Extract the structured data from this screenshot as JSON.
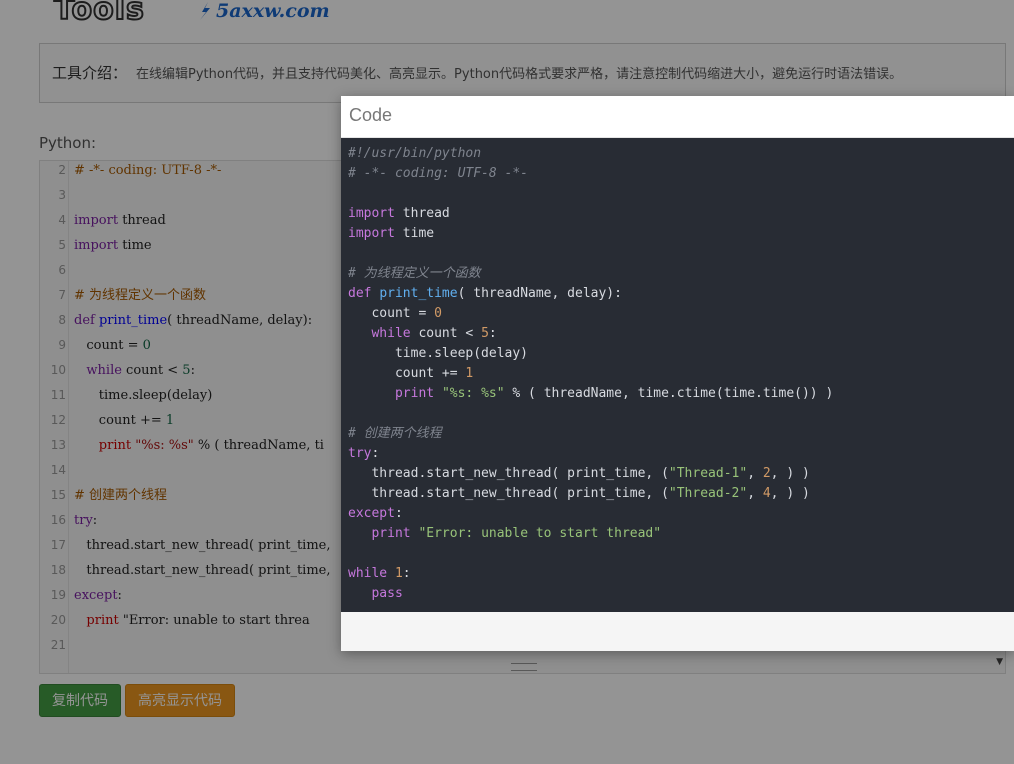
{
  "logo": {
    "tools_text": "Tools",
    "site_text": "5axxw.com"
  },
  "intro": {
    "label": "工具介绍：",
    "text": "在线编辑Python代码，并且支持代码美化、高亮显示。Python代码格式要求严格，请注意控制代码缩进大小，避免运行时语法错误。"
  },
  "editor": {
    "language_label": "Python:",
    "lines": [
      {
        "no": "2",
        "text": "# -*- coding: UTF-8 -*-"
      },
      {
        "no": "3",
        "text": ""
      },
      {
        "no": "4",
        "text": "import thread"
      },
      {
        "no": "5",
        "text": "import time"
      },
      {
        "no": "6",
        "text": ""
      },
      {
        "no": "7",
        "text": "# 为线程定义一个函数"
      },
      {
        "no": "8",
        "text": "def print_time( threadName, delay):"
      },
      {
        "no": "9",
        "text": "   count = 0"
      },
      {
        "no": "10",
        "text": "   while count < 5:"
      },
      {
        "no": "11",
        "text": "      time.sleep(delay)"
      },
      {
        "no": "12",
        "text": "      count += 1"
      },
      {
        "no": "13",
        "text": "      print \"%s: %s\" % ( threadName, ti"
      },
      {
        "no": "14",
        "text": ""
      },
      {
        "no": "15",
        "text": "# 创建两个线程"
      },
      {
        "no": "16",
        "text": "try:"
      },
      {
        "no": "17",
        "text": "   thread.start_new_thread( print_time,"
      },
      {
        "no": "18",
        "text": "   thread.start_new_thread( print_time,"
      },
      {
        "no": "19",
        "text": "except:"
      },
      {
        "no": "20",
        "text": "   print \"Error: unable to start threa"
      },
      {
        "no": "21",
        "text": ""
      }
    ]
  },
  "buttons": {
    "copy": "复制代码",
    "highlight": "高亮显示代码"
  },
  "modal": {
    "title": "Code",
    "code_lines": [
      "#!/usr/bin/python",
      "# -*- coding: UTF-8 -*-",
      "",
      "import thread",
      "import time",
      "",
      "# 为线程定义一个函数",
      "def print_time( threadName, delay):",
      "   count = 0",
      "   while count < 5:",
      "      time.sleep(delay)",
      "      count += 1",
      "      print \"%s: %s\" % ( threadName, time.ctime(time.time()) )",
      "",
      "# 创建两个线程",
      "try:",
      "   thread.start_new_thread( print_time, (\"Thread-1\", 2, ) )",
      "   thread.start_new_thread( print_time, (\"Thread-2\", 4, ) )",
      "except:",
      "   print \"Error: unable to start thread\"",
      "",
      "while 1:",
      "   pass"
    ]
  },
  "colors": {
    "modal_code_bg": "#282c34",
    "keyword": "#c678dd",
    "function": "#61afef",
    "number": "#d19a66",
    "string": "#98c379",
    "comment": "#7f848e",
    "copy_button": "#449d44",
    "highlight_button": "#ec971f"
  }
}
